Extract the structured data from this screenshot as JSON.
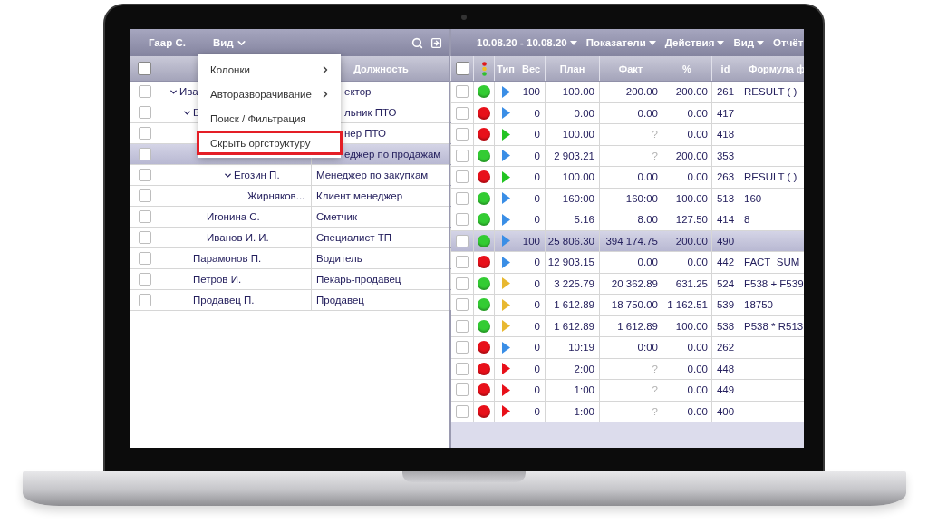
{
  "left_panel": {
    "toolbar": {
      "user": "Гаар С.",
      "view_menu": "Вид"
    },
    "header": {
      "all_checked": false,
      "position": "Должность"
    },
    "tree": [
      {
        "name": "Ива",
        "position": "ектор",
        "under_menu": true,
        "checked": false,
        "selected": false,
        "expanded": true,
        "children": [
          {
            "name": "В",
            "position": "льник ПТО",
            "under_menu": true,
            "checked": false,
            "selected": false,
            "expanded": true,
            "children": [
              {
                "position": "нер ПТО",
                "under_menu": true,
                "checked": false,
                "selected": false,
                "children": [
                  {
                    "position": "еджер по продажам",
                    "under_menu": true,
                    "checked": false,
                    "selected": true,
                    "children": [
                      {
                        "name": "Егозин П.",
                        "position": "Менеджер по закупкам",
                        "under_menu": false,
                        "checked": false,
                        "selected": false,
                        "expanded": true,
                        "children": [
                          {
                            "name": "Жирняков...",
                            "position": "Клиент менеджер",
                            "under_menu": false,
                            "checked": false,
                            "selected": false
                          }
                        ]
                      }
                    ]
                  }
                ]
              },
              {
                "name": "Игонина С.",
                "position": "Сметчик",
                "under_menu": false,
                "checked": false,
                "selected": false
              },
              {
                "name": "Иванов И. И.",
                "position": "Специалист ТП",
                "under_menu": false,
                "checked": false,
                "selected": false
              }
            ]
          },
          {
            "name": "Парамонов П.",
            "position": "Водитель",
            "under_menu": false,
            "checked": false,
            "selected": false
          },
          {
            "name": "Петров И.",
            "position": "Пекарь-продавец",
            "under_menu": false,
            "checked": false,
            "selected": false
          },
          {
            "name": "Продавец П.",
            "position": "Продавец",
            "under_menu": false,
            "checked": false,
            "selected": false
          }
        ]
      }
    ]
  },
  "view_menu": {
    "items": [
      {
        "label": "Колонки",
        "submenu": true,
        "highlighted": false
      },
      {
        "label": "Авторазворачивание",
        "submenu": true,
        "highlighted": false
      },
      {
        "label": "Поиск / Фильтрация",
        "submenu": false,
        "highlighted": false
      },
      {
        "label": "Скрыть оргструктуру",
        "submenu": false,
        "highlighted": true
      }
    ]
  },
  "right_panel": {
    "toolbar": {
      "period": "10.08.20 - 10.08.20",
      "menus": [
        "Показатели",
        "Действия",
        "Вид",
        "Отчёт"
      ]
    },
    "all_checked": false,
    "columns": [
      "Тип",
      "Вес",
      "План",
      "Факт",
      "%",
      "id",
      "Формула ф"
    ],
    "rows": [
      {
        "checked": false,
        "selected": false,
        "status": {
          "color": "#33cc33"
        },
        "type": {
          "color": "#3a8ee6"
        },
        "weight": "100",
        "plan": "100.00",
        "fact": "200.00",
        "fact_missing": false,
        "percent": "200.00",
        "id": "261",
        "formula": "RESULT ( )"
      },
      {
        "checked": false,
        "selected": false,
        "status": {
          "color": "#e8101a"
        },
        "type": {
          "color": "#3a8ee6"
        },
        "weight": "0",
        "plan": "0.00",
        "fact": "0.00",
        "fact_missing": false,
        "percent": "0.00",
        "id": "417"
      },
      {
        "checked": false,
        "selected": false,
        "status": {
          "color": "#e8101a"
        },
        "type": {
          "color": "#22c422"
        },
        "weight": "0",
        "plan": "100.00",
        "fact": "?",
        "fact_missing": true,
        "percent": "0.00",
        "id": "418"
      },
      {
        "checked": false,
        "selected": false,
        "status": {
          "color": "#33cc33"
        },
        "type": {
          "color": "#3a8ee6"
        },
        "weight": "0",
        "plan": "2 903.21",
        "fact": "?",
        "fact_missing": true,
        "percent": "200.00",
        "id": "353"
      },
      {
        "checked": false,
        "selected": false,
        "status": {
          "color": "#e8101a"
        },
        "type": {
          "color": "#22c422"
        },
        "weight": "0",
        "plan": "100.00",
        "fact": "0.00",
        "fact_missing": false,
        "percent": "0.00",
        "id": "263",
        "formula": "RESULT ( )"
      },
      {
        "checked": false,
        "selected": false,
        "status": {
          "color": "#33cc33"
        },
        "type": {
          "color": "#3a8ee6"
        },
        "weight": "0",
        "plan": "160:00",
        "fact": "160:00",
        "fact_missing": false,
        "percent": "100.00",
        "id": "513",
        "formula": "160"
      },
      {
        "checked": false,
        "selected": false,
        "status": {
          "color": "#33cc33"
        },
        "type": {
          "color": "#3a8ee6"
        },
        "weight": "0",
        "plan": "5.16",
        "fact": "8.00",
        "fact_missing": false,
        "percent": "127.50",
        "id": "414",
        "formula": "8"
      },
      {
        "checked": false,
        "selected": true,
        "status": {
          "color": "#33cc33"
        },
        "type": {
          "color": "#3a8ee6"
        },
        "weight": "100",
        "plan": "25 806.30",
        "fact": "394 174.75",
        "fact_missing": false,
        "percent": "200.00",
        "id": "490"
      },
      {
        "checked": false,
        "selected": false,
        "status": {
          "color": "#e8101a"
        },
        "type": {
          "color": "#3a8ee6"
        },
        "weight": "0",
        "plan": "12 903.15",
        "fact": "0.00",
        "fact_missing": false,
        "percent": "0.00",
        "id": "442",
        "formula": "FACT_SUM"
      },
      {
        "checked": false,
        "selected": false,
        "status": {
          "color": "#33cc33"
        },
        "type": {
          "color": "#e8b830"
        },
        "weight": "0",
        "plan": "3 225.79",
        "fact": "20 362.89",
        "fact_missing": false,
        "percent": "631.25",
        "id": "524",
        "formula": "F538 + F539"
      },
      {
        "checked": false,
        "selected": false,
        "status": {
          "color": "#33cc33"
        },
        "type": {
          "color": "#e8b830"
        },
        "weight": "0",
        "plan": "1 612.89",
        "fact": "18 750.00",
        "fact_missing": false,
        "percent": "1 162.51",
        "id": "539",
        "formula": "18750"
      },
      {
        "checked": false,
        "selected": false,
        "status": {
          "color": "#33cc33"
        },
        "type": {
          "color": "#e8b830"
        },
        "weight": "0",
        "plan": "1 612.89",
        "fact": "1 612.89",
        "fact_missing": false,
        "percent": "100.00",
        "id": "538",
        "formula": "P538 * R513"
      },
      {
        "checked": false,
        "selected": false,
        "status": {
          "color": "#e8101a"
        },
        "type": {
          "color": "#3a8ee6"
        },
        "weight": "0",
        "plan": "10:19",
        "fact": "0:00",
        "fact_missing": false,
        "percent": "0.00",
        "id": "262"
      },
      {
        "checked": false,
        "selected": false,
        "status": {
          "color": "#e8101a"
        },
        "type": {
          "color": "#e8101a"
        },
        "weight": "0",
        "plan": "2:00",
        "fact": "?",
        "fact_missing": true,
        "percent": "0.00",
        "id": "448"
      },
      {
        "checked": false,
        "selected": false,
        "status": {
          "color": "#e8101a"
        },
        "type": {
          "color": "#e8101a"
        },
        "weight": "0",
        "plan": "1:00",
        "fact": "?",
        "fact_missing": true,
        "percent": "0.00",
        "id": "449"
      },
      {
        "checked": false,
        "selected": false,
        "status": {
          "color": "#e8101a"
        },
        "type": {
          "color": "#e8101a"
        },
        "weight": "0",
        "plan": "1:00",
        "fact": "?",
        "fact_missing": true,
        "percent": "0.00",
        "id": "400"
      }
    ]
  }
}
